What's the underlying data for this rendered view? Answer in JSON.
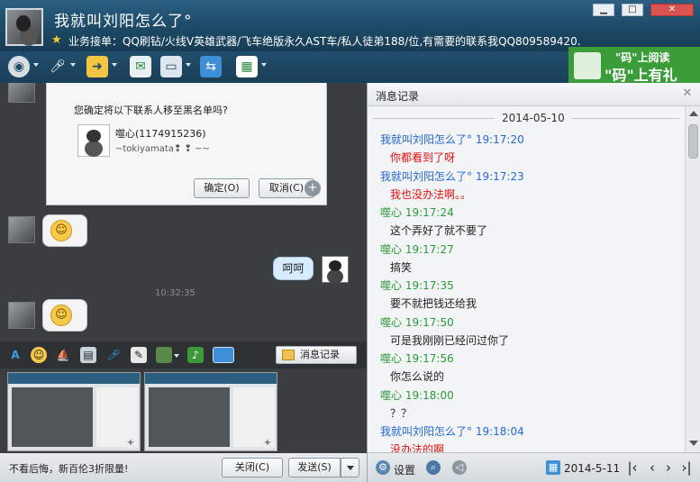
{
  "window": {
    "title": "我就叫刘阳怎么了°",
    "signature": "业务接单：QQ刷钻/火线V英雄武器/飞车绝版永久AST车/私人徒弟188/位,有需要的联系我QQ809589420.",
    "controls": {
      "minimize": "▁",
      "maximize": "□",
      "close": "✕"
    }
  },
  "toolbar": {
    "icons": [
      "camera-icon",
      "mic-icon",
      "file-transfer-icon",
      "sms-icon",
      "remote-desktop-icon",
      "screen-share-icon",
      "apps-icon"
    ]
  },
  "ad_banner": {
    "line1": "\"码\"上阅读",
    "line2": "\"码\"上有礼"
  },
  "blacklist_dialog": {
    "question": "您确定将以下联系人移至黑名单吗?",
    "contact_name": "噬心(1174915236)",
    "contact_sub": "~tokiyamata❢ ❢ ~~",
    "ok_label": "确定(O)",
    "cancel_label": "取消(C)"
  },
  "chat": {
    "my_bubble_text": "呵呵",
    "mid_time": "10:32:35"
  },
  "input_toolbar": {
    "history_label": "消息记录"
  },
  "bottom": {
    "ad_text": "不看后悔，新百伦3折限量!",
    "close_label": "关闭(C)",
    "send_label": "发送(S)"
  },
  "history_panel": {
    "title": "消息记录",
    "date": "2014-05-10",
    "messages": [
      {
        "sender": "我就叫刘阳怎么了°",
        "time": "19:17:20",
        "text": "你都看到了呀",
        "mine": true
      },
      {
        "sender": "我就叫刘阳怎么了°",
        "time": "19:17:23",
        "text": "我也没办法啊。。",
        "mine": true
      },
      {
        "sender": "噬心",
        "time": "19:17:24",
        "text": "这个弄好了就不要了",
        "mine": false
      },
      {
        "sender": "噬心",
        "time": "19:17:27",
        "text": "搞笑",
        "mine": false
      },
      {
        "sender": "噬心",
        "time": "19:17:35",
        "text": "要不就把钱还给我",
        "mine": false
      },
      {
        "sender": "噬心",
        "time": "19:17:50",
        "text": "可是我刚刚已经问过你了",
        "mine": false
      },
      {
        "sender": "噬心",
        "time": "19:17:56",
        "text": "你怎么说的",
        "mine": false
      },
      {
        "sender": "噬心",
        "time": "19:18:00",
        "text": "？？",
        "mine": false
      },
      {
        "sender": "我就叫刘阳怎么了°",
        "time": "19:18:04",
        "text": "没办法的啊",
        "mine": true
      }
    ],
    "footer": {
      "settings_label": "设置",
      "date_value": "2014-5-11",
      "nav": {
        "first": "|‹",
        "prev": "‹",
        "next": "›",
        "last": "›|"
      }
    }
  },
  "colors": {
    "mine_sender": "#2468d6",
    "mine_text": "#e01010",
    "other_sender": "#2a9a3a",
    "other_text": "#222222"
  }
}
